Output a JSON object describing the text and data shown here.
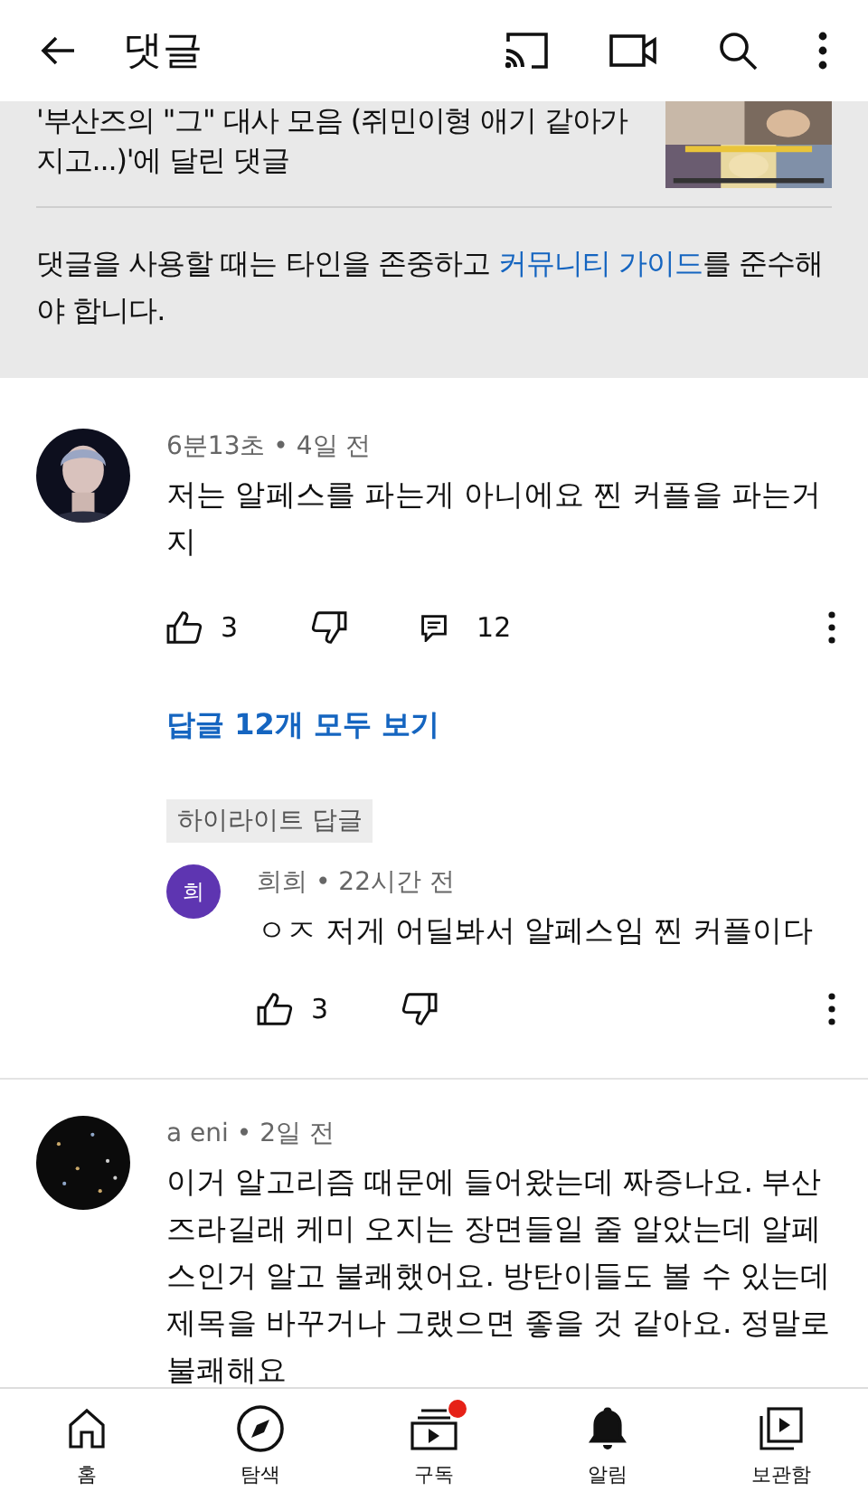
{
  "header": {
    "title": "댓글"
  },
  "video": {
    "title": "'부산즈의 \"그\" 대사 모음 (쥐민이형 애기 같아가 지고...)'에 달린 댓글"
  },
  "guideline": {
    "before": "댓글을 사용할 때는 타인을 존중하고 ",
    "link": "커뮤니티 가이드",
    "after": "를 준수해야 합니다."
  },
  "comments": [
    {
      "kind": "comment",
      "meta": "6분13초 • 4일 전",
      "text": "저는 알페스를 파는게 아니에요 찐 커플을 파는거지",
      "likes": "3",
      "replies": "12",
      "view_replies": "답글 12개 모두 보기",
      "highlight": {
        "label": "하이라이트 답글",
        "reply": {
          "initial": "희",
          "color": "#5e35b1",
          "meta": "희희 • 22시간 전",
          "text": "ㅇㅈ 저게 어딜봐서 알페스임 찐 커플이다",
          "likes": "3"
        }
      }
    },
    {
      "kind": "comment",
      "meta": "a eni • 2일 전",
      "text": "이거 알고리즘 때문에 들어왔는데 짜증나요. 부산즈라길래 케미 오지는 장면들일 줄 알았는데 알페스인거 알고 불쾌했어요. 방탄이들도 볼 수 있는데 제목을 바꾸거나 그랬으면 좋을 것 같아요. 정말로 불쾌해요"
    }
  ],
  "nav": [
    {
      "kind": "home",
      "label": "홈",
      "new": false
    },
    {
      "kind": "explore",
      "label": "탐색",
      "new": false
    },
    {
      "kind": "subscriptions",
      "label": "구독",
      "new": true
    },
    {
      "kind": "notifications",
      "label": "알림",
      "new": false
    },
    {
      "kind": "library",
      "label": "보관함",
      "new": false
    }
  ]
}
